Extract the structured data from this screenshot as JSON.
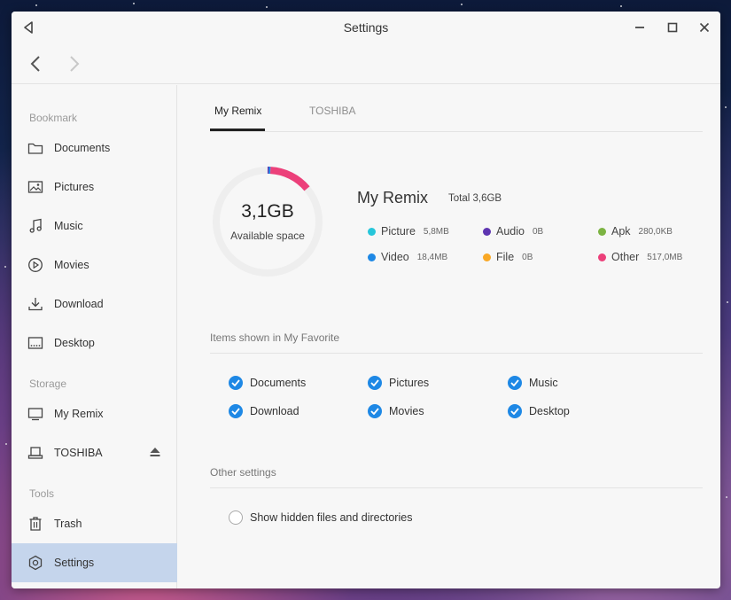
{
  "window": {
    "title": "Settings"
  },
  "sidebar": {
    "sections": {
      "bookmark": "Bookmark",
      "storage": "Storage",
      "tools": "Tools"
    },
    "bookmarks": [
      {
        "label": "Documents",
        "icon": "folder-icon"
      },
      {
        "label": "Pictures",
        "icon": "image-icon"
      },
      {
        "label": "Music",
        "icon": "music-icon"
      },
      {
        "label": "Movies",
        "icon": "play-icon"
      },
      {
        "label": "Download",
        "icon": "download-icon"
      },
      {
        "label": "Desktop",
        "icon": "desktop-icon"
      }
    ],
    "storage": [
      {
        "label": "My Remix",
        "icon": "monitor-icon"
      },
      {
        "label": "TOSHIBA",
        "icon": "usb-drive-icon"
      }
    ],
    "tools": [
      {
        "label": "Trash",
        "icon": "trash-icon"
      },
      {
        "label": "Settings",
        "icon": "gear-icon",
        "active": true
      }
    ]
  },
  "tabs": [
    {
      "label": "My Remix",
      "active": true
    },
    {
      "label": "TOSHIBA",
      "active": false
    }
  ],
  "storage_info": {
    "available": "3,1GB",
    "available_label": "Available space",
    "device_name": "My Remix",
    "total": "Total 3,6GB",
    "used_fraction": 0.139,
    "legend": [
      {
        "label": "Picture",
        "size": "5,8MB",
        "color": "#26c6da"
      },
      {
        "label": "Audio",
        "size": "0B",
        "color": "#5e35b1"
      },
      {
        "label": "Apk",
        "size": "280,0KB",
        "color": "#7cb342"
      },
      {
        "label": "Video",
        "size": "18,4MB",
        "color": "#1e88e5"
      },
      {
        "label": "File",
        "size": "0B",
        "color": "#f9a825"
      },
      {
        "label": "Other",
        "size": "517,0MB",
        "color": "#ec407a"
      }
    ]
  },
  "favorites": {
    "title": "Items shown in My Favorite",
    "items": [
      {
        "label": "Documents",
        "checked": true
      },
      {
        "label": "Pictures",
        "checked": true
      },
      {
        "label": "Music",
        "checked": true
      },
      {
        "label": "Download",
        "checked": true
      },
      {
        "label": "Movies",
        "checked": true
      },
      {
        "label": "Desktop",
        "checked": true
      }
    ]
  },
  "other_settings": {
    "title": "Other settings",
    "show_hidden_label": "Show hidden files and directories",
    "show_hidden": false
  },
  "colors": {
    "accent": "#1e88e5",
    "active_row": "#c5d5ec",
    "ring_track": "#eeeeee"
  }
}
